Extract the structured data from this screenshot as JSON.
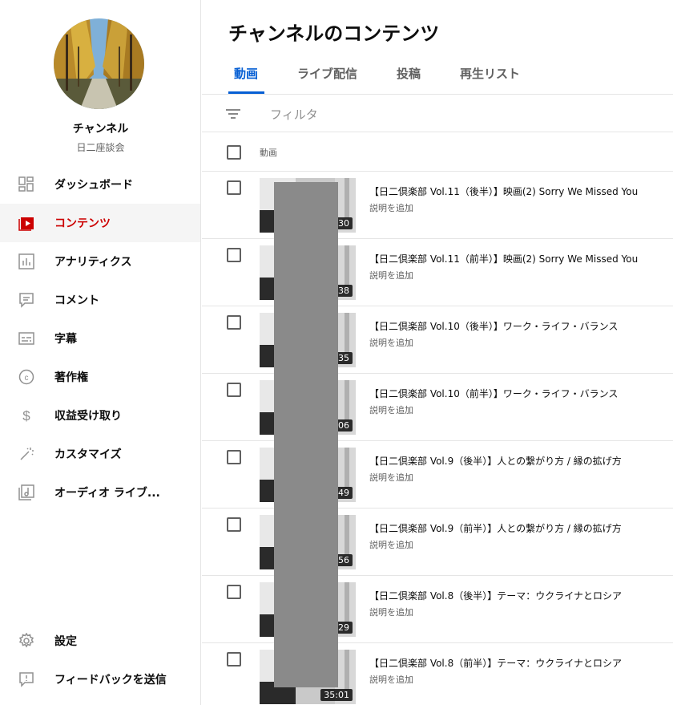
{
  "sidebar": {
    "channel_name": "チャンネル",
    "channel_sub": "日二座談会",
    "items": [
      {
        "label": "ダッシュボード",
        "icon": "dashboard-icon"
      },
      {
        "label": "コンテンツ",
        "icon": "content-icon",
        "active": true
      },
      {
        "label": "アナリティクス",
        "icon": "analytics-icon"
      },
      {
        "label": "コメント",
        "icon": "comment-icon"
      },
      {
        "label": "字幕",
        "icon": "subtitles-icon"
      },
      {
        "label": "著作権",
        "icon": "copyright-icon"
      },
      {
        "label": "収益受け取り",
        "icon": "dollar-icon"
      },
      {
        "label": "カスタマイズ",
        "icon": "magic-wand-icon"
      },
      {
        "label": "オーディオ ライブ...",
        "icon": "audio-library-icon"
      }
    ],
    "bottom_items": [
      {
        "label": "設定",
        "icon": "gear-icon"
      },
      {
        "label": "フィードバックを送信",
        "icon": "feedback-icon"
      }
    ]
  },
  "main": {
    "page_title": "チャンネルのコンテンツ",
    "tabs": [
      {
        "label": "動画",
        "active": true
      },
      {
        "label": "ライブ配信"
      },
      {
        "label": "投稿"
      },
      {
        "label": "再生リスト"
      }
    ],
    "filter_placeholder": "フィルタ",
    "list_header": "動画",
    "add_description": "説明を追加",
    "videos": [
      {
        "title": "【日二倶楽部 Vol.11（後半）】映画(2) Sorry We Missed You",
        "duration": "30"
      },
      {
        "title": "【日二倶楽部 Vol.11（前半）】映画(2) Sorry We Missed You",
        "duration": "38"
      },
      {
        "title": "【日二倶楽部 Vol.10（後半）】ワーク・ライフ・バランス",
        "duration": "35"
      },
      {
        "title": "【日二倶楽部 Vol.10（前半）】ワーク・ライフ・バランス",
        "duration": "06"
      },
      {
        "title": "【日二倶楽部 Vol.9（後半）】人との繋がり方 / 縁の拡げ方",
        "duration": "49"
      },
      {
        "title": "【日二倶楽部 Vol.9（前半）】人との繋がり方 / 縁の拡げ方",
        "duration": "56"
      },
      {
        "title": "【日二倶楽部 Vol.8（後半）】テーマ：ウクライナとロシア",
        "duration": "29"
      },
      {
        "title": "【日二倶楽部 Vol.8（前半）】テーマ：ウクライナとロシア",
        "duration": "35:01"
      }
    ]
  },
  "colors": {
    "accent_red": "#cc0000",
    "accent_blue": "#065fd4"
  }
}
